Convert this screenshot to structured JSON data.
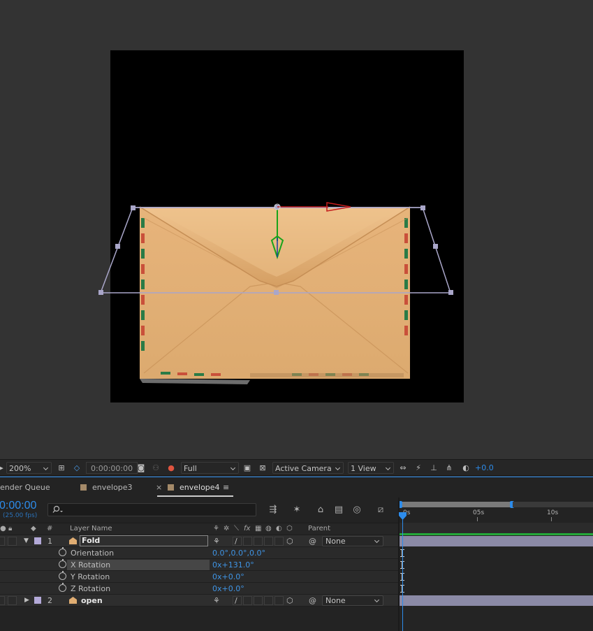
{
  "viewer": {
    "zoom": "200%",
    "timecode": "0:00:00:00",
    "resolution": "Full",
    "camera": "Active Camera",
    "view_layout": "1 View",
    "exposure": "+0.0"
  },
  "tabs": {
    "render_queue": "ender Queue",
    "envelope3": "envelope3",
    "close_glyph": "×",
    "envelope4": "envelope4",
    "menu_glyph": "≡"
  },
  "timeline": {
    "timecode": "0:00:00",
    "fps": "(25.00 fps)",
    "ruler": [
      "0s",
      "05s",
      "10s"
    ]
  },
  "header": {
    "num": "#",
    "layer_name": "Layer Name",
    "parent": "Parent"
  },
  "layers": [
    {
      "index": "1",
      "name": "Fold",
      "parent": "None",
      "properties": [
        {
          "label": "Orientation",
          "value": "0.0°,0.0°,0.0°"
        },
        {
          "label": "X Rotation",
          "value": "0x+131.0°"
        },
        {
          "label": "Y Rotation",
          "value": "0x+0.0°"
        },
        {
          "label": "Z Rotation",
          "value": "0x+0.0°"
        }
      ]
    },
    {
      "index": "2",
      "name": "open",
      "parent": "None"
    }
  ],
  "colors": {
    "accent": "#2d8ceb",
    "label_lavender": "#b3a9d8",
    "envelope": "#e0ad72",
    "x_axis": "#c41d1d",
    "y_axis": "#1aa31a"
  }
}
